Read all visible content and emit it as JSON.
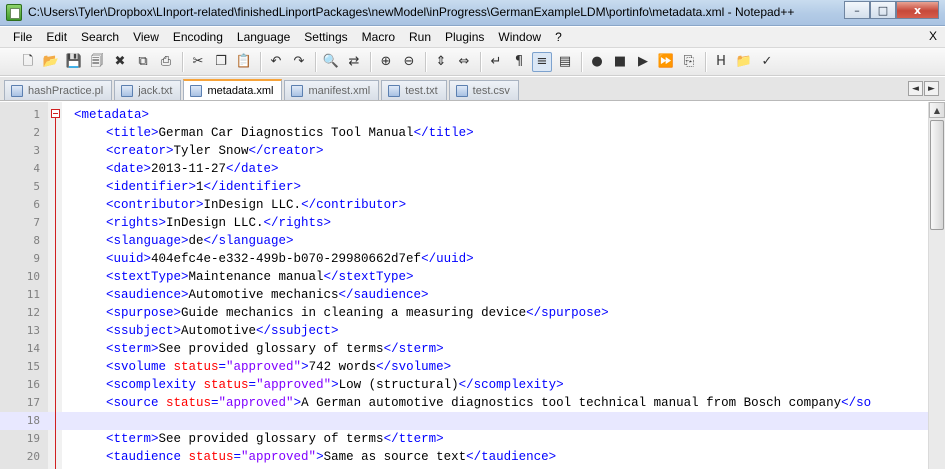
{
  "window": {
    "title": "C:\\Users\\Tyler\\Dropbox\\LInport-related\\finishedLinportPackages\\newModel\\inProgress\\GermanExampleLDM\\portinfo\\metadata.xml - Notepad++",
    "minimize": "–",
    "maximize": "□",
    "close": "x"
  },
  "menu": {
    "items": [
      "File",
      "Edit",
      "Search",
      "View",
      "Encoding",
      "Language",
      "Settings",
      "Macro",
      "Run",
      "Plugins",
      "Window",
      "?"
    ],
    "close_doc": "X"
  },
  "toolbar": {
    "buttons": [
      {
        "icon": "new-file-icon",
        "glyph": "🗋"
      },
      {
        "icon": "open-file-icon",
        "glyph": "📂"
      },
      {
        "icon": "save-icon",
        "glyph": "💾"
      },
      {
        "icon": "save-all-icon",
        "glyph": "🗐"
      },
      {
        "icon": "close-file-icon",
        "glyph": "✖"
      },
      {
        "icon": "close-all-icon",
        "glyph": "⧉"
      },
      {
        "icon": "print-icon",
        "glyph": "⎙"
      },
      {
        "sep": true
      },
      {
        "icon": "cut-icon",
        "glyph": "✂"
      },
      {
        "icon": "copy-icon",
        "glyph": "❐"
      },
      {
        "icon": "paste-icon",
        "glyph": "📋"
      },
      {
        "sep": true
      },
      {
        "icon": "undo-icon",
        "glyph": "↶"
      },
      {
        "icon": "redo-icon",
        "glyph": "↷"
      },
      {
        "sep": true
      },
      {
        "icon": "find-icon",
        "glyph": "🔍"
      },
      {
        "icon": "replace-icon",
        "glyph": "⇄"
      },
      {
        "sep": true
      },
      {
        "icon": "zoom-in-icon",
        "glyph": "⊕"
      },
      {
        "icon": "zoom-out-icon",
        "glyph": "⊖"
      },
      {
        "sep": true
      },
      {
        "icon": "sync-vertical-icon",
        "glyph": "⇕"
      },
      {
        "icon": "sync-horizontal-icon",
        "glyph": "⇔"
      },
      {
        "sep": true
      },
      {
        "icon": "word-wrap-icon",
        "glyph": "↵"
      },
      {
        "icon": "show-all-chars-icon",
        "glyph": "¶"
      },
      {
        "icon": "indent-guide-icon",
        "glyph": "≡",
        "active": true
      },
      {
        "icon": "document-map-icon",
        "glyph": "▤"
      },
      {
        "sep": true
      },
      {
        "icon": "record-macro-icon",
        "glyph": "●"
      },
      {
        "icon": "stop-macro-icon",
        "glyph": "■"
      },
      {
        "icon": "play-macro-icon",
        "glyph": "▶"
      },
      {
        "icon": "run-macro-multiple-icon",
        "glyph": "⏩"
      },
      {
        "icon": "save-macro-icon",
        "glyph": "⎘"
      },
      {
        "sep": true
      },
      {
        "icon": "html-tag-icon",
        "glyph": "H"
      },
      {
        "icon": "plugin-folder-icon",
        "glyph": "📁"
      },
      {
        "icon": "spell-check-icon",
        "glyph": "✓"
      }
    ]
  },
  "tabs": [
    {
      "label": "hashPractice.pl",
      "active": false
    },
    {
      "label": "jack.txt",
      "active": false
    },
    {
      "label": "metadata.xml",
      "active": true
    },
    {
      "label": "manifest.xml",
      "active": false
    },
    {
      "label": "test.txt",
      "active": false
    },
    {
      "label": "test.csv",
      "active": false
    }
  ],
  "tab_nav": {
    "prev": "◄",
    "next": "►"
  },
  "scrollbar": {
    "up": "▲"
  },
  "editor": {
    "current_line": 18,
    "lines": [
      {
        "n": "1",
        "indent": 0,
        "segs": [
          [
            "tag",
            "<metadata>"
          ]
        ]
      },
      {
        "n": "2",
        "indent": 1,
        "segs": [
          [
            "tag",
            "<title>"
          ],
          [
            "txt",
            "German Car Diagnostics Tool Manual"
          ],
          [
            "tag",
            "</title>"
          ]
        ]
      },
      {
        "n": "3",
        "indent": 1,
        "segs": [
          [
            "tag",
            "<creator>"
          ],
          [
            "txt",
            "Tyler Snow"
          ],
          [
            "tag",
            "</creator>"
          ]
        ]
      },
      {
        "n": "4",
        "indent": 1,
        "segs": [
          [
            "tag",
            "<date>"
          ],
          [
            "txt",
            "2013-11-27"
          ],
          [
            "tag",
            "</date>"
          ]
        ]
      },
      {
        "n": "5",
        "indent": 1,
        "segs": [
          [
            "tag",
            "<identifier>"
          ],
          [
            "txt",
            "1"
          ],
          [
            "tag",
            "</identifier>"
          ]
        ]
      },
      {
        "n": "6",
        "indent": 1,
        "segs": [
          [
            "tag",
            "<contributor>"
          ],
          [
            "txt",
            "InDesign LLC."
          ],
          [
            "tag",
            "</contributor>"
          ]
        ]
      },
      {
        "n": "7",
        "indent": 1,
        "segs": [
          [
            "tag",
            "<rights>"
          ],
          [
            "txt",
            "InDesign LLC."
          ],
          [
            "tag",
            "</rights>"
          ]
        ]
      },
      {
        "n": "8",
        "indent": 1,
        "segs": [
          [
            "tag",
            "<slanguage>"
          ],
          [
            "txt",
            "de"
          ],
          [
            "tag",
            "</slanguage>"
          ]
        ]
      },
      {
        "n": "9",
        "indent": 1,
        "segs": [
          [
            "tag",
            "<uuid>"
          ],
          [
            "txt",
            "404efc4e-e332-499b-b070-29980662d7ef"
          ],
          [
            "tag",
            "</uuid>"
          ]
        ]
      },
      {
        "n": "10",
        "indent": 1,
        "segs": [
          [
            "tag",
            "<stextType>"
          ],
          [
            "txt",
            "Maintenance manual"
          ],
          [
            "tag",
            "</stextType>"
          ]
        ]
      },
      {
        "n": "11",
        "indent": 1,
        "segs": [
          [
            "tag",
            "<saudience>"
          ],
          [
            "txt",
            "Automotive mechanics"
          ],
          [
            "tag",
            "</saudience>"
          ]
        ]
      },
      {
        "n": "12",
        "indent": 1,
        "segs": [
          [
            "tag",
            "<spurpose>"
          ],
          [
            "txt",
            "Guide mechanics in cleaning a measuring device"
          ],
          [
            "tag",
            "</spurpose>"
          ]
        ]
      },
      {
        "n": "13",
        "indent": 1,
        "segs": [
          [
            "tag",
            "<ssubject>"
          ],
          [
            "txt",
            "Automotive"
          ],
          [
            "tag",
            "</ssubject>"
          ]
        ]
      },
      {
        "n": "14",
        "indent": 1,
        "segs": [
          [
            "tag",
            "<sterm>"
          ],
          [
            "txt",
            "See provided glossary of terms"
          ],
          [
            "tag",
            "</sterm>"
          ]
        ]
      },
      {
        "n": "15",
        "indent": 1,
        "segs": [
          [
            "tag",
            "<svolume "
          ],
          [
            "attr",
            "status"
          ],
          [
            "tag",
            "="
          ],
          [
            "val",
            "\"approved\""
          ],
          [
            "tag",
            ">"
          ],
          [
            "txt",
            "742 words"
          ],
          [
            "tag",
            "</svolume>"
          ]
        ]
      },
      {
        "n": "16",
        "indent": 1,
        "segs": [
          [
            "tag",
            "<scomplexity "
          ],
          [
            "attr",
            "status"
          ],
          [
            "tag",
            "="
          ],
          [
            "val",
            "\"approved\""
          ],
          [
            "tag",
            ">"
          ],
          [
            "txt",
            "Low (structural)"
          ],
          [
            "tag",
            "</scomplexity>"
          ]
        ]
      },
      {
        "n": "17",
        "indent": 1,
        "segs": [
          [
            "tag",
            "<source "
          ],
          [
            "attr",
            "status"
          ],
          [
            "tag",
            "="
          ],
          [
            "val",
            "\"approved\""
          ],
          [
            "tag",
            ">"
          ],
          [
            "txt",
            "A German automotive diagnostics tool technical manual from Bosch company"
          ],
          [
            "tag",
            "</so"
          ]
        ]
      },
      {
        "n": "18",
        "indent": 0,
        "segs": []
      },
      {
        "n": "19",
        "indent": 1,
        "segs": [
          [
            "tag",
            "<tterm>"
          ],
          [
            "txt",
            "See provided glossary of terms"
          ],
          [
            "tag",
            "</tterm>"
          ]
        ]
      },
      {
        "n": "20",
        "indent": 1,
        "segs": [
          [
            "tag",
            "<taudience "
          ],
          [
            "attr",
            "status"
          ],
          [
            "tag",
            "="
          ],
          [
            "val",
            "\"approved\""
          ],
          [
            "tag",
            ">"
          ],
          [
            "txt",
            "Same as source text"
          ],
          [
            "tag",
            "</taudience>"
          ]
        ]
      }
    ]
  },
  "colors": {
    "tag": "#0000ff",
    "attribute": "#ff0000",
    "attribute_value": "#8000ff",
    "text": "#000000",
    "current_line": "#e8e8ff",
    "fold_marker": "#d02020",
    "active_tab_accent": "#f6a33a"
  }
}
